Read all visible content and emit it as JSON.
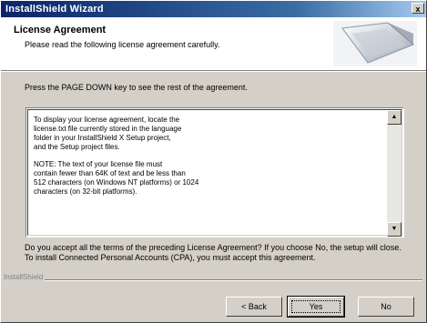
{
  "window": {
    "title": "InstallShield Wizard",
    "close_label": "x"
  },
  "header": {
    "title": "License Agreement",
    "subtitle": "Please read the following license agreement carefully."
  },
  "instruction": "Press the PAGE DOWN key to see the rest of the agreement.",
  "license": {
    "paragraphs": [
      "To display your license agreement, locate the\nlicense.txt file currently stored in the language\nfolder in your InstallShield X Setup project,\nand the Setup project files.",
      "NOTE: The text of your license file must\ncontain fewer than 64K of text and be less than\n512 characters (on Windows NT platforms) or 1024\ncharacters (on 32-bit platforms)."
    ]
  },
  "question": "Do you accept all the terms of the preceding License Agreement? If you choose No, the setup will close. To install Connected Personal Accounts (CPA), you must accept this agreement.",
  "brand": "InstallShield",
  "buttons": {
    "back": "< Back",
    "yes": "Yes",
    "no": "No"
  }
}
